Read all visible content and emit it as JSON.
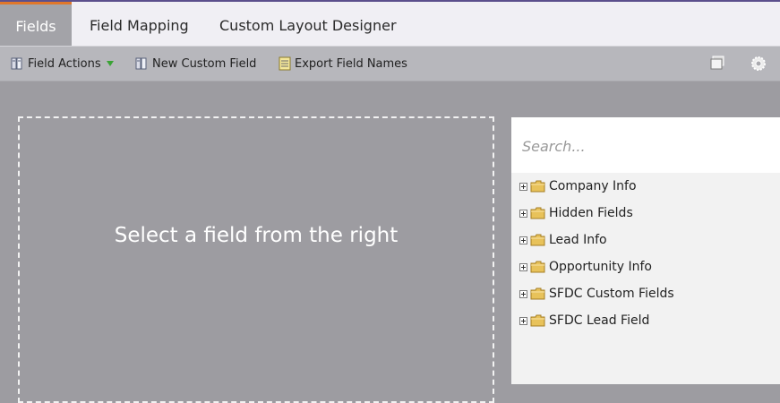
{
  "tabs": [
    {
      "label": "Fields",
      "active": true
    },
    {
      "label": "Field Mapping",
      "active": false
    },
    {
      "label": "Custom Layout Designer",
      "active": false
    }
  ],
  "toolbar": {
    "field_actions_label": "Field Actions",
    "new_custom_field_label": "New Custom Field",
    "export_field_names_label": "Export Field Names",
    "icons": [
      "field-actions-icon",
      "dropdown-arrow-icon",
      "new-custom-field-icon",
      "export-icon",
      "window-icon",
      "gear-icon"
    ]
  },
  "main": {
    "placeholder_text": "Select a field from the right"
  },
  "search": {
    "placeholder": "Search..."
  },
  "tree": {
    "items": [
      {
        "label": "Company Info"
      },
      {
        "label": "Hidden Fields"
      },
      {
        "label": "Lead Info"
      },
      {
        "label": "Opportunity Info"
      },
      {
        "label": "SFDC Custom Fields"
      },
      {
        "label": "SFDC Lead Field"
      }
    ]
  },
  "colors": {
    "accent": "#e0772a",
    "top_line": "#5b4f8c",
    "active_tab_bg": "#a3a3a8",
    "canvas_bg": "#9d9ca1",
    "dropdown_arrow": "#3aa335",
    "folder": "#e8c25a"
  }
}
